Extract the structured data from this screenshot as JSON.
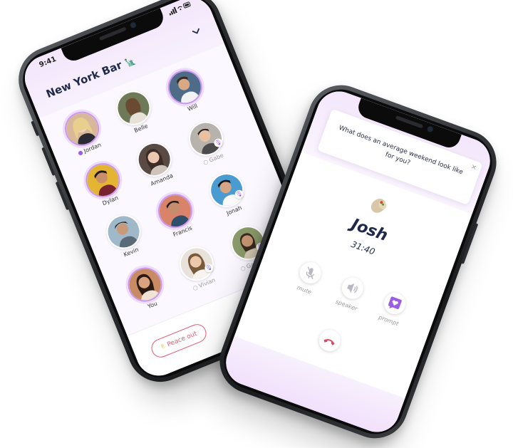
{
  "bar_phone": {
    "status_time": "9:41",
    "room_title": "New York Bar",
    "room_emoji": "🗽",
    "people": [
      {
        "name": "Jordan",
        "state": "speaking",
        "prefix": "discord"
      },
      {
        "name": "Belle",
        "state": "listening",
        "prefix": ""
      },
      {
        "name": "Will",
        "state": "speaking",
        "prefix": ""
      },
      {
        "name": "Dylan",
        "state": "speaking",
        "prefix": ""
      },
      {
        "name": "Amanda",
        "state": "listening",
        "prefix": ""
      },
      {
        "name": "Gabe",
        "state": "muted",
        "prefix": "mic"
      },
      {
        "name": "Kevin",
        "state": "listening",
        "prefix": ""
      },
      {
        "name": "Francis",
        "state": "speaking",
        "prefix": ""
      },
      {
        "name": "Jonah",
        "state": "listening",
        "prefix": "mic"
      },
      {
        "name": "You",
        "state": "speaking",
        "prefix": ""
      },
      {
        "name": "Vivian",
        "state": "muted",
        "prefix": "mic"
      },
      {
        "name": "Gabriella",
        "state": "muted",
        "prefix": "mic"
      }
    ],
    "peace_out_label": "Peace out",
    "peace_out_emoji": "✌",
    "add_symbol": "+",
    "accent_color": "#9b5de5",
    "leave_color": "#e35a76"
  },
  "call_phone": {
    "prompt_text": "What does an average weekend look like for you?",
    "prompt_close": "×",
    "caller_name": "Josh",
    "call_time": "31:40",
    "controls": [
      {
        "label": "mute",
        "icon": "mic-off-icon"
      },
      {
        "label": "speaker",
        "icon": "speaker-icon"
      },
      {
        "label": "prompt",
        "icon": "prompt-heart-icon"
      }
    ],
    "hangup_icon": "phone-hangup-icon"
  }
}
